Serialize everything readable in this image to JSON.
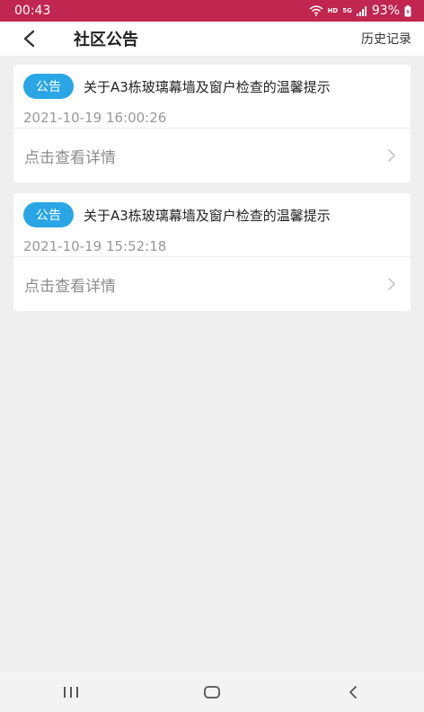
{
  "status": {
    "time": "00:43",
    "hd": "HD",
    "net": "5G",
    "battery": "93%"
  },
  "header": {
    "title": "社区公告",
    "history_label": "历史记录"
  },
  "notices": [
    {
      "tag": "公告",
      "title": "关于A3栋玻璃幕墙及窗户检查的温馨提示",
      "time": "2021-10-19 16:00:26",
      "link": "点击查看详情"
    },
    {
      "tag": "公告",
      "title": "关于A3栋玻璃幕墙及窗户检查的温馨提示",
      "time": "2021-10-19 15:52:18",
      "link": "点击查看详情"
    }
  ],
  "colors": {
    "status_bar": "#c0264f",
    "tag": "#2aa6e6",
    "background": "#efefef"
  },
  "icons": {
    "back": "chevron-left-icon",
    "row_arrow": "chevron-right-icon",
    "nav_recents": "recents-icon",
    "nav_home": "home-icon",
    "nav_back": "back-icon"
  }
}
